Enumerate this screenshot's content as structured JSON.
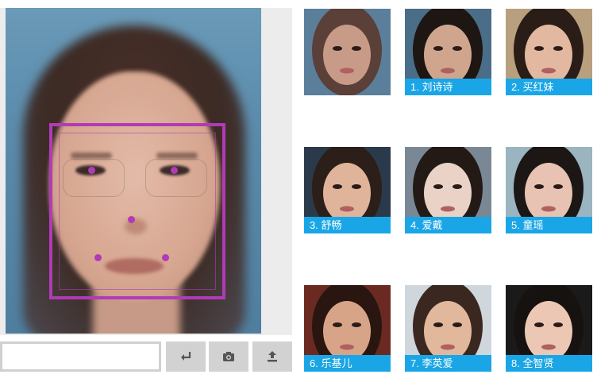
{
  "main_face": {
    "landmarks": [
      "left-eye",
      "right-eye",
      "nose-tip",
      "mouth-left",
      "mouth-right"
    ]
  },
  "controls": {
    "url_value": "",
    "buttons": [
      {
        "name": "submit-button",
        "icon": "enter-icon"
      },
      {
        "name": "camera-button",
        "icon": "camera-icon"
      },
      {
        "name": "upload-button",
        "icon": "upload-icon"
      }
    ]
  },
  "colors": {
    "accent": "#b13ab8",
    "caption_bg": "#1aa6e6",
    "button_bg": "#d2d2d2"
  },
  "gallery": {
    "items": [
      {
        "label": "",
        "bg": "#c89a88",
        "hair": "#5a4038"
      },
      {
        "label": "1. 刘诗诗",
        "bg": "#cfa58e",
        "hair": "#1e1612"
      },
      {
        "label": "2. 买红妹",
        "bg": "#e2b8a0",
        "hair": "#2a1c16"
      },
      {
        "label": "3. 舒畅",
        "bg": "#e0b49a",
        "hair": "#2c1e18"
      },
      {
        "label": "4. 爱戴",
        "bg": "#ead2c6",
        "hair": "#231a16"
      },
      {
        "label": "5. 童瑶",
        "bg": "#e8c2b2",
        "hair": "#1c1614"
      },
      {
        "label": "6. 乐基儿",
        "bg": "#d8a488",
        "hair": "#2a1610"
      },
      {
        "label": "7. 李英爱",
        "bg": "#e2b89c",
        "hair": "#3a2820"
      },
      {
        "label": "8. 全智贤",
        "bg": "#ecc8b4",
        "hair": "#161210"
      }
    ]
  }
}
